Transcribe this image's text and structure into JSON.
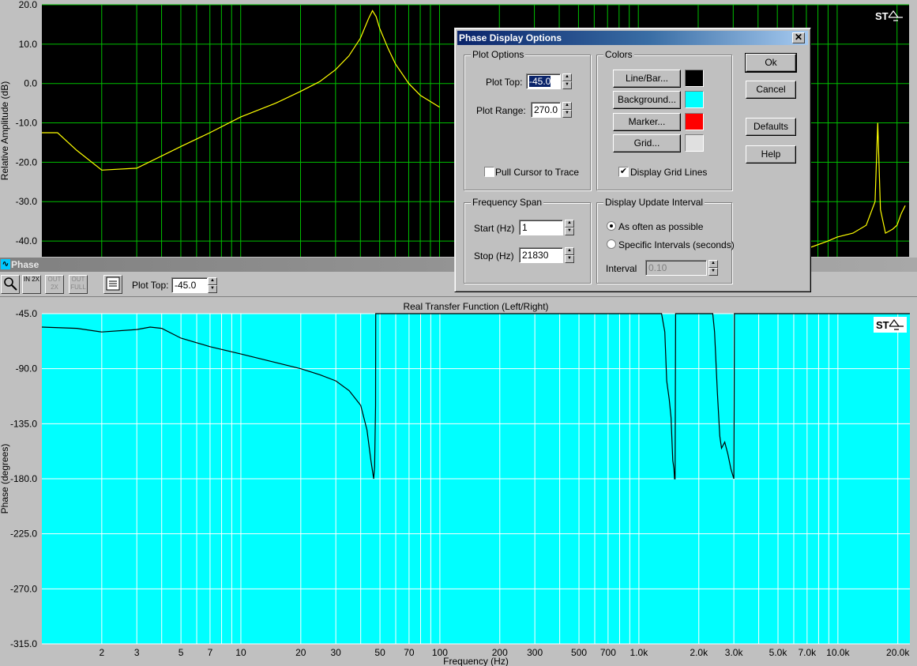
{
  "amplitude_panel": {
    "y_label": "Relative Amplitude (dB)",
    "y_ticks": [
      "20.0",
      "10.0",
      "0.0",
      "-10.0",
      "-20.0",
      "-30.0",
      "-40.0"
    ]
  },
  "phase_window": {
    "title": "Phase",
    "toolbar": {
      "zoom_in_label": "IN 2X",
      "zoom_out_label": "OUT 2X",
      "zoom_full_label": "OUT FULL",
      "plot_top_label": "Plot Top:",
      "plot_top_value": "-45.0"
    }
  },
  "chart_data": [
    {
      "type": "line",
      "xscale": "log",
      "ylabel": "Relative Amplitude (dB)",
      "ylim": [
        -44,
        20
      ],
      "xlim": [
        1,
        23000
      ],
      "background": "#000000",
      "line_color": "#ffff00",
      "grid_color": "#00c000",
      "series": [
        {
          "x": [
            1,
            1.2,
            1.5,
            2,
            3,
            5,
            7,
            10,
            15,
            20,
            25,
            30,
            35,
            40,
            44,
            46,
            48,
            50,
            55,
            60,
            70,
            80,
            100
          ],
          "y": [
            -12.5,
            -12.5,
            -17,
            -22,
            -21.5,
            -16,
            -12.5,
            -8.5,
            -5,
            -2,
            0.5,
            3.5,
            7,
            11.5,
            16.5,
            18.5,
            17,
            14,
            9,
            5,
            0,
            -3,
            -6
          ]
        },
        {
          "x": [
            5000,
            7000,
            9000,
            10000,
            12000,
            14000,
            15500,
            16000,
            16500,
            17500,
            19000,
            20000,
            21000,
            22000
          ],
          "y": [
            -43,
            -42,
            -40,
            -39,
            -38,
            -36,
            -30,
            -10,
            -32,
            -38,
            -37,
            -36,
            -33,
            -31
          ]
        }
      ]
    },
    {
      "type": "line",
      "title": "Real Transfer Function (Left/Right)",
      "xscale": "log",
      "xlabel": "Frequency (Hz)",
      "ylabel": "Phase (degrees)",
      "ylim": [
        -315,
        -45
      ],
      "xlim": [
        1,
        23000
      ],
      "background": "#00ffff",
      "line_color": "#000000",
      "grid_color": "#ffffff",
      "y_ticks": [
        "-45.0",
        "-90.0",
        "-135.0",
        "-180.0",
        "-225.0",
        "-270.0",
        "-315.0"
      ],
      "x_ticks": [
        "2",
        "3",
        "5",
        "7",
        "10",
        "20",
        "30",
        "50",
        "70",
        "100",
        "200",
        "300",
        "500",
        "700",
        "1.0k",
        "2.0k",
        "3.0k",
        "5.0k",
        "7.0k",
        "10.0k",
        "20.0k"
      ],
      "series": [
        {
          "x": [
            1,
            1.5,
            2,
            3,
            3.5,
            4,
            5,
            7,
            10,
            15,
            20,
            25,
            30,
            35,
            40,
            43,
            45,
            46.5,
            47,
            47.5,
            47.6,
            1300,
            1350,
            1380,
            1420,
            1450,
            1480,
            1500,
            1510,
            1520,
            1530,
            2350,
            2400,
            2480,
            2550,
            2600,
            2700,
            2800,
            2900,
            3000,
            3010,
            3020,
            23000
          ],
          "y": [
            -56,
            -57,
            -60,
            -58,
            -56,
            -57,
            -65,
            -72,
            -78,
            -85,
            -90,
            -95,
            -100,
            -108,
            -120,
            -140,
            -165,
            -180,
            -170,
            -120,
            -45,
            -45,
            -60,
            -100,
            -115,
            -130,
            -165,
            -172,
            -180,
            -180,
            -45,
            -45,
            -60,
            -110,
            -145,
            -155,
            -150,
            -160,
            -172,
            -180,
            -120,
            -45,
            -45
          ]
        }
      ]
    }
  ],
  "dialog": {
    "title": "Phase Display Options",
    "close_glyph": "✕",
    "plot_options": {
      "group_label": "Plot Options",
      "plot_top_label": "Plot Top:",
      "plot_top_value": "-45.0",
      "plot_range_label": "Plot Range:",
      "plot_range_value": "270.0",
      "pull_cursor_label": "Pull Cursor to Trace",
      "pull_cursor_checked": false
    },
    "colors": {
      "group_label": "Colors",
      "line_bar_label": "Line/Bar...",
      "line_bar_color": "#000000",
      "background_label": "Background...",
      "background_color": "#00ffff",
      "marker_label": "Marker...",
      "marker_color": "#ff0000",
      "grid_label": "Grid...",
      "grid_color": "#e0e0e0",
      "display_grid_label": "Display Grid Lines",
      "display_grid_checked": true
    },
    "frequency_span": {
      "group_label": "Frequency Span",
      "start_label": "Start (Hz)",
      "start_value": "1",
      "stop_label": "Stop (Hz)",
      "stop_value": "21830"
    },
    "update_interval": {
      "group_label": "Display Update Interval",
      "option_often": "As often as possible",
      "option_specific": "Specific Intervals (seconds)",
      "selected": "As often as possible",
      "interval_label": "Interval",
      "interval_value": "0.10"
    },
    "buttons": {
      "ok": "Ok",
      "cancel": "Cancel",
      "defaults": "Defaults",
      "help": "Help"
    }
  }
}
